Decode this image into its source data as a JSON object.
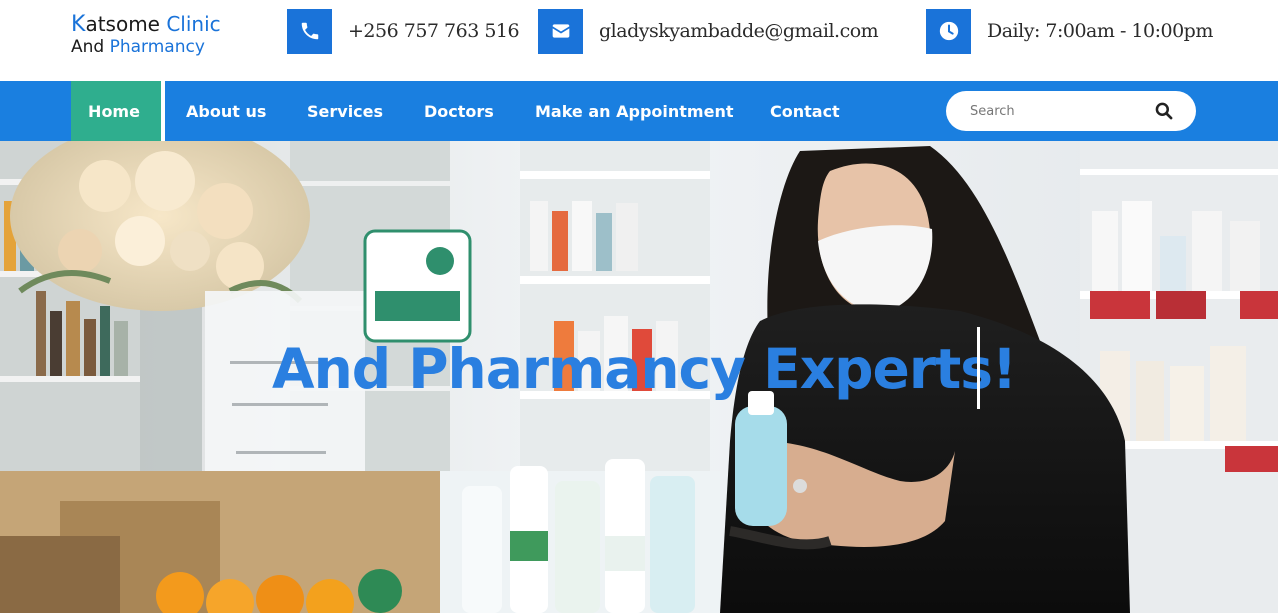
{
  "brand": {
    "line1_initial": "K",
    "line1_rest": "atsome ",
    "line1_accent": "Clinic",
    "line2_plain": "And ",
    "line2_accent": "Pharmancy"
  },
  "contacts": {
    "phone": "+256 757 763 516",
    "email": "gladyskyambadde@gmail.com",
    "hours": "Daily: 7:00am - 10:00pm"
  },
  "icons": {
    "phone": "phone-icon",
    "email": "envelope-icon",
    "hours": "clock-icon",
    "search": "search-icon"
  },
  "nav": {
    "items": [
      {
        "label": "Home",
        "active": true
      },
      {
        "label": "About us"
      },
      {
        "label": "Services"
      },
      {
        "label": "Doctors"
      },
      {
        "label": "Make an Appointment"
      },
      {
        "label": "Contact"
      }
    ]
  },
  "search": {
    "placeholder": "Search"
  },
  "hero": {
    "headline": "And Pharmancy Experts!"
  },
  "colors": {
    "brand_blue": "#1a73d9",
    "nav_blue": "#1a7fe0",
    "active_green": "#2fae8e",
    "headline_blue": "#2a7fe0"
  }
}
